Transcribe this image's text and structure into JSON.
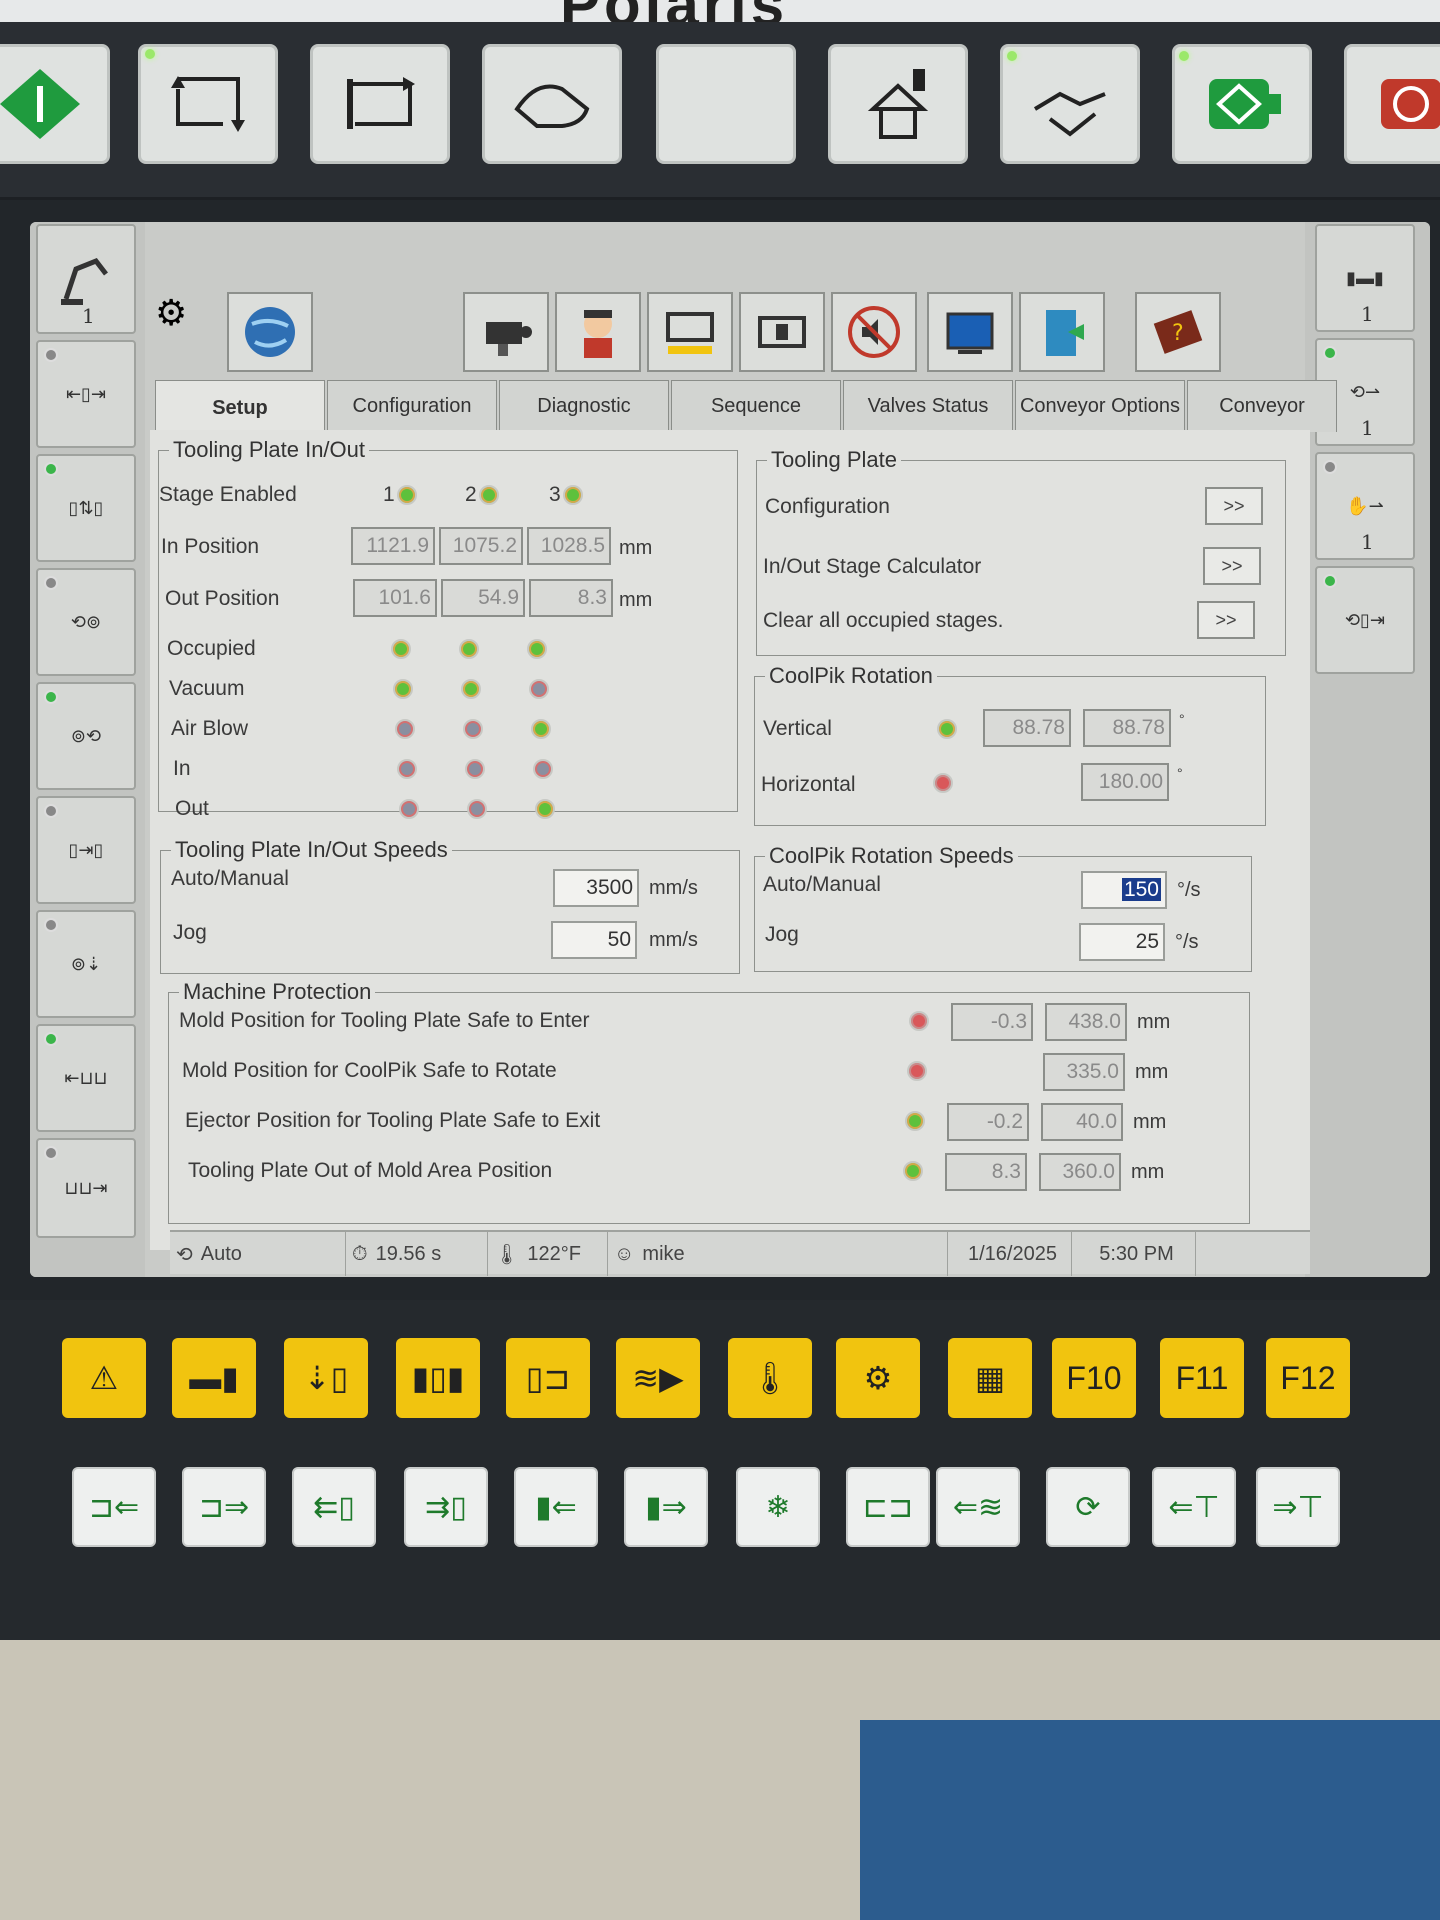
{
  "brand": {
    "logo": "Polaris"
  },
  "tabs": [
    {
      "label": "Setup"
    },
    {
      "label": "Configuration"
    },
    {
      "label": "Diagnostic"
    },
    {
      "label": "Sequence"
    },
    {
      "label": "Valves Status"
    },
    {
      "label": "Conveyor Options"
    },
    {
      "label": "Conveyor"
    }
  ],
  "tooling_inout": {
    "title": "Tooling Plate In/Out",
    "stage_enabled_label": "Stage Enabled",
    "stages": [
      "1",
      "2",
      "3"
    ],
    "in_position_label": "In Position",
    "in_position": [
      "1121.9",
      "1075.2",
      "1028.5"
    ],
    "out_position_label": "Out Position",
    "out_position": [
      "101.6",
      "54.9",
      "8.3"
    ],
    "unit": "mm",
    "rows": [
      {
        "label": "Occupied",
        "states": [
          "green",
          "green",
          "green"
        ]
      },
      {
        "label": "Vacuum",
        "states": [
          "green",
          "green",
          "gray"
        ]
      },
      {
        "label": "Air Blow",
        "states": [
          "gray",
          "gray",
          "green"
        ]
      },
      {
        "label": "In",
        "states": [
          "gray",
          "gray",
          "gray"
        ]
      },
      {
        "label": "Out",
        "states": [
          "gray",
          "gray",
          "green"
        ]
      }
    ]
  },
  "tooling_plate": {
    "title": "Tooling Plate",
    "items": [
      "Configuration",
      "In/Out Stage Calculator",
      "Clear all occupied stages."
    ],
    "button": ">>"
  },
  "coolpik_rotation": {
    "title": "CoolPik Rotation",
    "vertical_label": "Vertical",
    "vertical": [
      "88.78",
      "88.78"
    ],
    "horizontal_label": "Horizontal",
    "horizontal": "180.00",
    "unit": "°"
  },
  "tooling_speeds": {
    "title": "Tooling Plate In/Out Speeds",
    "auto_label": "Auto/Manual",
    "auto": "3500",
    "jog_label": "Jog",
    "jog": "50",
    "unit": "mm/s"
  },
  "coolpik_speeds": {
    "title": "CoolPik Rotation Speeds",
    "auto_label": "Auto/Manual",
    "auto": "150",
    "jog_label": "Jog",
    "jog": "25",
    "unit": "°/s"
  },
  "machine_protection": {
    "title": "Machine Protection",
    "rows": [
      {
        "label": "Mold Position for Tooling Plate Safe to Enter",
        "state": "red",
        "min": "-0.3",
        "max": "438.0"
      },
      {
        "label": "Mold Position for CoolPik Safe to Rotate",
        "state": "red",
        "min": "",
        "max": "335.0"
      },
      {
        "label": "Ejector Position for Tooling Plate Safe to Exit",
        "state": "green",
        "min": "-0.2",
        "max": "40.0"
      },
      {
        "label": "Tooling Plate Out of Mold Area Position",
        "state": "green",
        "min": "8.3",
        "max": "360.0"
      }
    ],
    "unit": "mm"
  },
  "status_bar": {
    "mode": "Auto",
    "cycle_time": "19.56 s",
    "temperature": "122°F",
    "user": "mike",
    "date": "1/16/2025",
    "time": "5:30 PM"
  },
  "rail_numbers": {
    "left": "1",
    "right_a": "1",
    "right_b": "1",
    "right_c": "1"
  },
  "function_keys": [
    "F10",
    "F11",
    "F12"
  ]
}
